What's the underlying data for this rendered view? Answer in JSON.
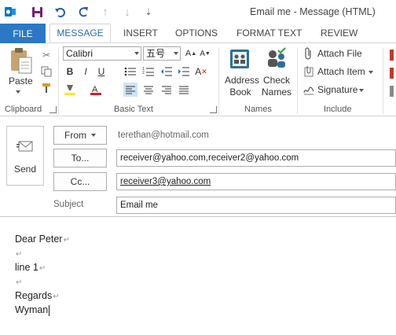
{
  "window": {
    "title": "Email me - Message (HTML)"
  },
  "tabs": [
    "FILE",
    "MESSAGE",
    "INSERT",
    "OPTIONS",
    "FORMAT TEXT",
    "REVIEW"
  ],
  "ribbon": {
    "clipboard": {
      "paste_label": "Paste",
      "group_label": "Clipboard"
    },
    "basic_text": {
      "font_name": "Calibri",
      "font_size": "五号",
      "group_label": "Basic Text"
    },
    "names": {
      "address_book_label": [
        "Address",
        "Book"
      ],
      "check_names_label": [
        "Check",
        "Names"
      ],
      "group_label": "Names"
    },
    "include": {
      "attach_file": "Attach File",
      "attach_item": "Attach Item",
      "signature": "Signature",
      "group_label": "Include"
    }
  },
  "compose": {
    "send_label": "Send",
    "from_label": "From",
    "from_address": "terethan@hotmail.com",
    "to_label": "To...",
    "to_value": "receiver@yahoo.com,receiver2@yahoo.com",
    "cc_label": "Cc...",
    "cc_value": "receiver3@yahoo.com",
    "subject_label": "Subject",
    "subject_value": "Email me"
  },
  "body_lines": [
    "Dear Peter",
    "",
    "line 1",
    "",
    "Regards",
    "Wyman"
  ],
  "colors": {
    "accent": "#2b78c5",
    "highlight": "#ffee00",
    "font_color": "#e81123"
  },
  "icons": [
    "save-icon",
    "undo-icon",
    "redo-icon",
    "up-arrow-icon",
    "down-arrow-icon",
    "customize-icon",
    "paste-icon",
    "cut-icon",
    "copy-icon",
    "format-painter-icon",
    "address-book-icon",
    "check-names-icon",
    "paperclip-icon",
    "attach-item-icon",
    "signature-icon",
    "send-envelope-icon"
  ]
}
